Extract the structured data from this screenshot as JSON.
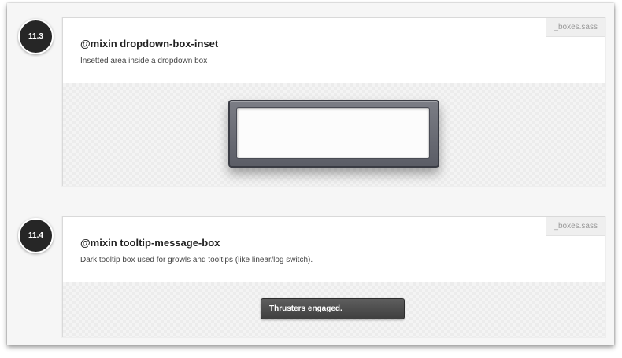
{
  "sections": [
    {
      "number": "11.3",
      "title": "@mixin dropdown-box-inset",
      "description": "Insetted area inside a dropdown box",
      "file": "_boxes.sass"
    },
    {
      "number": "11.4",
      "title": "@mixin tooltip-message-box",
      "description": "Dark tooltip box used for growls and tooltips (like linear/log switch).",
      "file": "_boxes.sass",
      "demo_text": "Thrusters engaged."
    }
  ]
}
